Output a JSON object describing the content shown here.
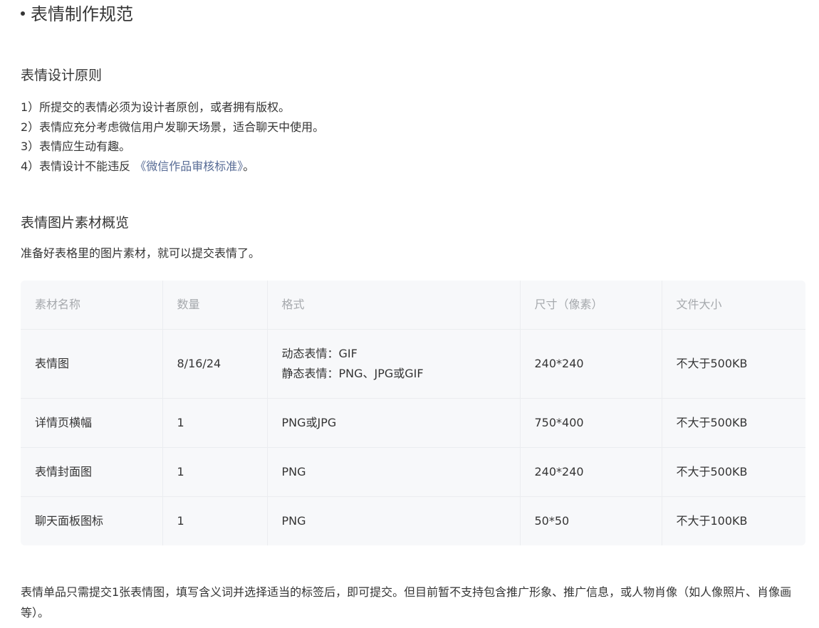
{
  "title": "表情制作规范",
  "design_principles": {
    "heading": "表情设计原则",
    "items": [
      "1）所提交的表情必须为设计者原创，或者拥有版权。",
      "2）表情应充分考虑微信用户发聊天场景，适合聊天中使用。",
      "3）表情应生动有趣。"
    ],
    "item4_prefix": "4）表情设计不能违反",
    "item4_link": "《微信作品审核标准》",
    "item4_suffix": "。"
  },
  "materials": {
    "heading": "表情图片素材概览",
    "intro": "准备好表格里的图片素材，就可以提交表情了。",
    "table": {
      "headers": [
        "素材名称",
        "数量",
        "格式",
        "尺寸（像素）",
        "文件大小"
      ],
      "rows": [
        {
          "name": "表情图",
          "count": "8/16/24",
          "format_lines": [
            "动态表情：GIF",
            "静态表情：PNG、JPG或GIF"
          ],
          "size": "240*240",
          "filesize": "不大于500KB"
        },
        {
          "name": "详情页横幅",
          "count": "1",
          "format_lines": [
            "PNG或JPG"
          ],
          "size": "750*400",
          "filesize": "不大于500KB"
        },
        {
          "name": "表情封面图",
          "count": "1",
          "format_lines": [
            "PNG"
          ],
          "size": "240*240",
          "filesize": "不大于500KB"
        },
        {
          "name": "聊天面板图标",
          "count": "1",
          "format_lines": [
            "PNG"
          ],
          "size": "50*50",
          "filesize": "不大于100KB"
        }
      ]
    }
  },
  "footer_note": "表情单品只需提交1张表情图，填写含义词并选择适当的标签后，即可提交。但目前暂不支持包含推广形象、推广信息，或人物肖像（如人像照片、肖像画等）。",
  "colors": {
    "text": "#353535",
    "link": "#576b95",
    "header_text": "#a6a9ad",
    "table_bg": "#f7f8fa"
  }
}
